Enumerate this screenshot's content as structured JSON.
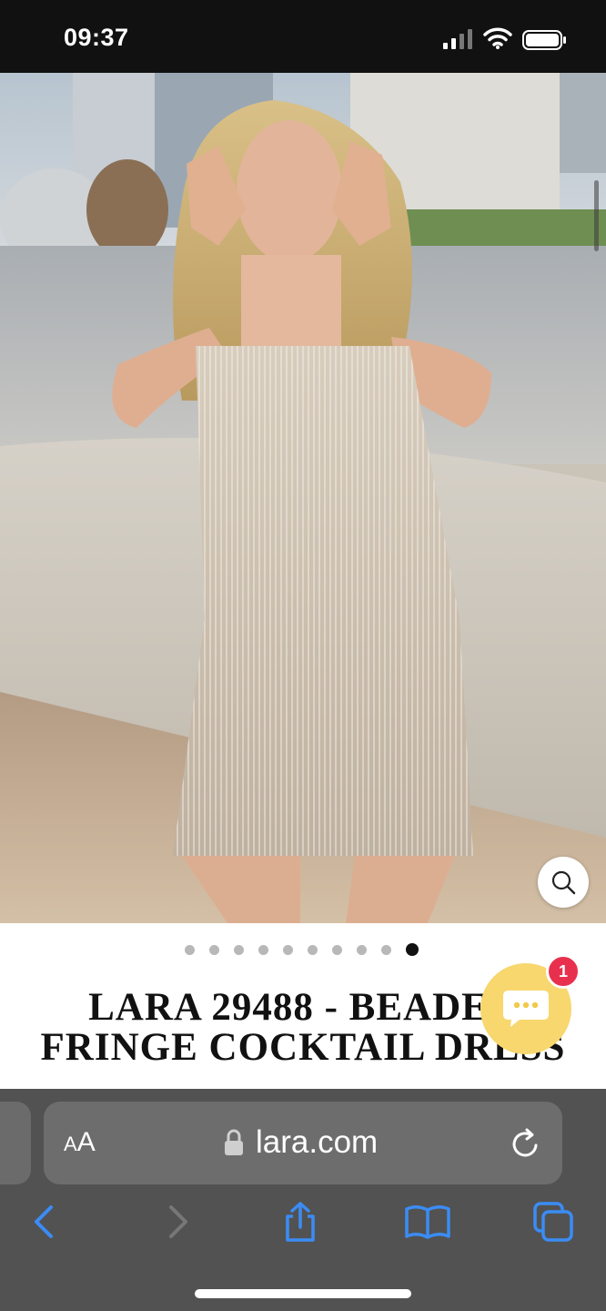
{
  "status_bar": {
    "time": "09:37",
    "signal_icon": "cellular-signal-icon",
    "wifi_icon": "wifi-icon",
    "battery_icon": "battery-icon"
  },
  "product": {
    "image_icon": "product-photo",
    "zoom_icon": "magnifier-icon",
    "title": "LARA 29488 - BEADED FRINGE COCKTAIL DRESS",
    "carousel": {
      "dot_count": 10,
      "active_index": 9
    }
  },
  "chat": {
    "icon": "chat-bubble-icon",
    "badge_count": "1",
    "accent_color": "#f7d76e",
    "badge_color": "#e8304e"
  },
  "browser": {
    "aa_label_big": "A",
    "aa_label_small": "A",
    "url": "lara.com",
    "lock_icon": "lock-icon",
    "reload_icon": "reload-icon",
    "toolbar": {
      "back_icon": "chevron-left-icon",
      "forward_icon": "chevron-right-icon",
      "share_icon": "share-icon",
      "bookmarks_icon": "book-icon",
      "tabs_icon": "tabs-icon"
    },
    "accent_color": "#3b8cf5"
  }
}
